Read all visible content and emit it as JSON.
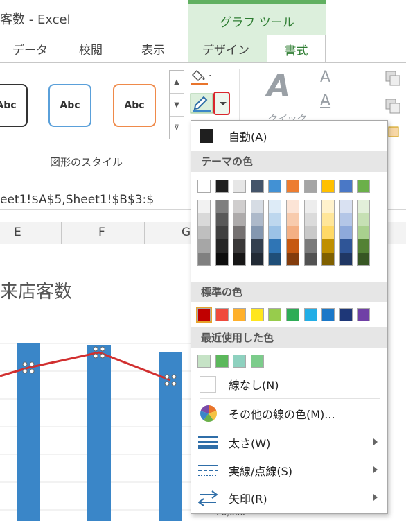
{
  "window": {
    "title": "客数 - Excel",
    "tool_header": "グラフ ツール"
  },
  "tabs": {
    "data": "データ",
    "review": "校閲",
    "view": "表示",
    "design": "デザイン",
    "format": "書式"
  },
  "ribbon": {
    "style_labels": [
      "Abc",
      "Abc",
      "Abc"
    ],
    "group_label": "図形のスタイル",
    "wordart_label": "クイック",
    "text_a": "A"
  },
  "formula_bar": {
    "text": "eet1!$A$5,Sheet1!$B$3:$"
  },
  "columns": [
    "E",
    "F",
    "G"
  ],
  "chart": {
    "title": "来店客数",
    "axis_tick": "20,000",
    "bar_color": "#3a86c8",
    "line_color": "#d12f2f"
  },
  "menu": {
    "auto": "自動(A)",
    "theme_header": "テーマの色",
    "standard_header": "標準の色",
    "recent_header": "最近使用した色",
    "no_line": "線なし(N)",
    "more_colors": "その他の線の色(M)...",
    "weight": "太さ(W)",
    "dashes": "実線/点線(S)",
    "arrows": "矢印(R)",
    "theme_top": [
      "#ffffff",
      "#1f1f1f",
      "#e6e6e6",
      "#44546a",
      "#4291d4",
      "#ed7d31",
      "#a5a5a5",
      "#ffc000",
      "#4a78c6",
      "#6bb04a"
    ],
    "theme_shades": [
      [
        "#f2f2f2",
        "#d9d9d9",
        "#bfbfbf",
        "#a6a6a6",
        "#808080"
      ],
      [
        "#7f7f7f",
        "#595959",
        "#404040",
        "#262626",
        "#0d0d0d"
      ],
      [
        "#d0cece",
        "#aeabab",
        "#757171",
        "#3a3838",
        "#171616"
      ],
      [
        "#d6dce4",
        "#adb9ca",
        "#8497b0",
        "#333f4f",
        "#222a35"
      ],
      [
        "#ddebf7",
        "#bdd7ee",
        "#9bc2e6",
        "#2f75b5",
        "#1f4e78"
      ],
      [
        "#fce4d6",
        "#f8cbad",
        "#f4b084",
        "#c65911",
        "#833c0c"
      ],
      [
        "#ededed",
        "#dbdbdb",
        "#c9c9c9",
        "#7b7b7b",
        "#525252"
      ],
      [
        "#fff2cc",
        "#ffe699",
        "#ffd966",
        "#bf8f00",
        "#806000"
      ],
      [
        "#d9e1f2",
        "#b4c6e7",
        "#8ea9db",
        "#2f5597",
        "#203764"
      ],
      [
        "#e2efda",
        "#c6e0b4",
        "#a9d08e",
        "#548235",
        "#375623"
      ]
    ],
    "standard": [
      "#c00000",
      "#f04a3c",
      "#ffb02b",
      "#ffe61e",
      "#97cc4c",
      "#2eac56",
      "#22aee6",
      "#1b78c8",
      "#1e3778",
      "#7040a6"
    ],
    "recent": [
      "#c6e3c6",
      "#5cb85c",
      "#8ed1bf",
      "#7ccc8b"
    ]
  }
}
